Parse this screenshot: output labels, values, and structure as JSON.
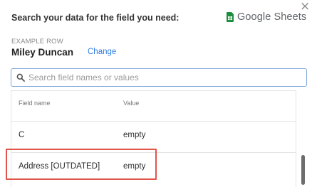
{
  "dialog": {
    "close_glyph": "×",
    "title": "Search your data for the field you need:"
  },
  "source": {
    "label": "Google Sheets",
    "icon": "google-sheets-icon",
    "color": "#1e8e3e"
  },
  "example_row": {
    "label": "EXAMPLE ROW",
    "name": "Miley Duncan",
    "change_label": "Change"
  },
  "search": {
    "icon": "search-icon",
    "placeholder": "Search field names or values",
    "value": ""
  },
  "table": {
    "columns": [
      "Field name",
      "Value"
    ],
    "rows": [
      {
        "field": "C",
        "value": "empty"
      },
      {
        "field": "Address [OUTDATED]",
        "value": "empty",
        "highlighted": true
      }
    ]
  },
  "colors": {
    "accent": "#2f7de1",
    "highlight_border": "#e1544a"
  }
}
